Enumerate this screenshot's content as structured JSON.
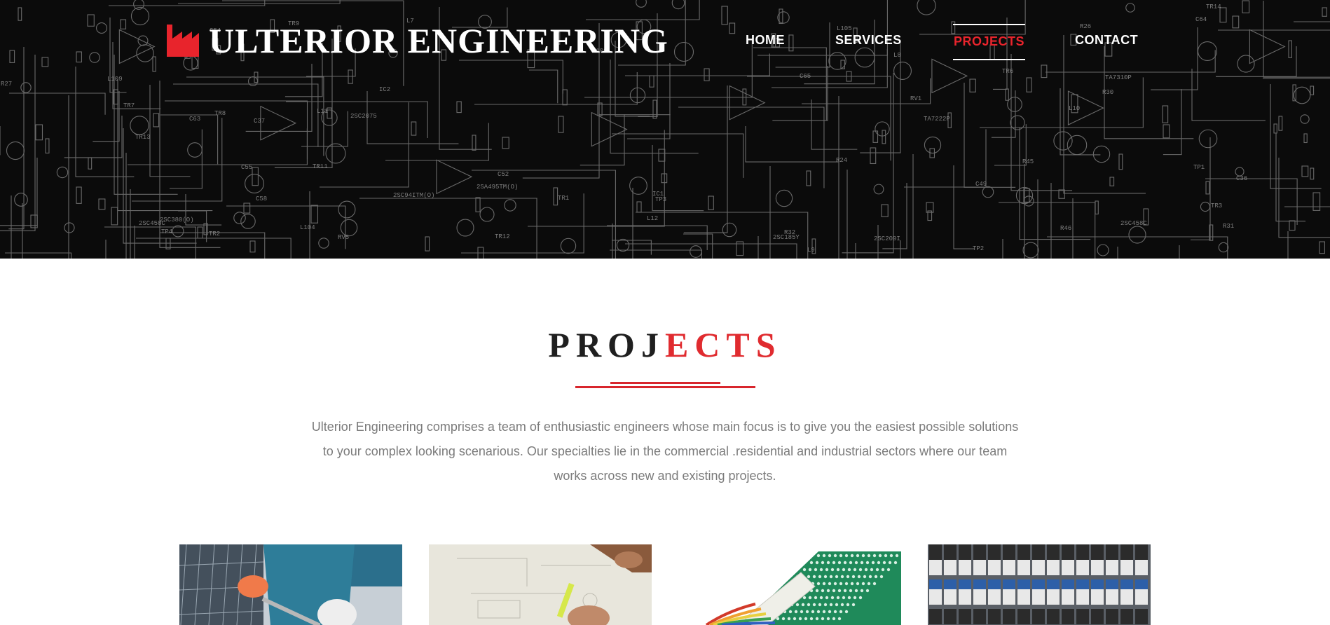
{
  "brand": {
    "name": "ULTERIOR ENGINEERING",
    "accent_color": "#e8242c",
    "logo_icon": "factory-icon"
  },
  "nav": {
    "items": [
      {
        "label": "HOME",
        "active": false
      },
      {
        "label": "SERVICES",
        "active": false
      },
      {
        "label": "PROJECTS",
        "active": true
      },
      {
        "label": "CONTACT",
        "active": false
      }
    ]
  },
  "hero": {
    "background": "circuit-schematic-image",
    "schematic_labels": [
      "2SC2075",
      "2SC209I",
      "2SC94ITM(O)",
      "2SC458C",
      "TA7222P",
      "2SC185Y",
      "2SC380(O)",
      "TA7310P",
      "2SC458C",
      "2SA495TM(O)",
      "TR1",
      "TR2",
      "TR3",
      "TR6",
      "TR7",
      "TR8",
      "TR9",
      "TR11",
      "TR12",
      "TR13",
      "TR14",
      "TP1",
      "TP2",
      "TP3",
      "TP4",
      "IC1",
      "IC2",
      "L7",
      "L8",
      "L9",
      "L10",
      "R24",
      "R26",
      "R27",
      "RV1",
      "RV5",
      "C54",
      "C58",
      "L104",
      "L105",
      "L108",
      "L109",
      "R45",
      "R46",
      "C63",
      "C64",
      "C65",
      "C49",
      "C52",
      "C55",
      "L11",
      "L12",
      "R30",
      "R31",
      "R32",
      "C36",
      "C37"
    ]
  },
  "projects_section": {
    "title_dark": "PROJ",
    "title_red": "ECTS",
    "intro_lines": [
      "Ulterior Engineering comprises a team of enthusiastic engineers whose main focus is to give you the easiest possible solutions",
      "to your complex looking scenarious. Our specialties lie in the commercial .residential and industrial sectors where our team",
      "works across new and existing projects."
    ]
  },
  "projects": [
    {
      "image": "solar-panel-installation-photo"
    },
    {
      "image": "blueprint-drafting-photo"
    },
    {
      "image": "circuit-board-connector-photo"
    },
    {
      "image": "electrical-panel-relays-photo"
    }
  ]
}
